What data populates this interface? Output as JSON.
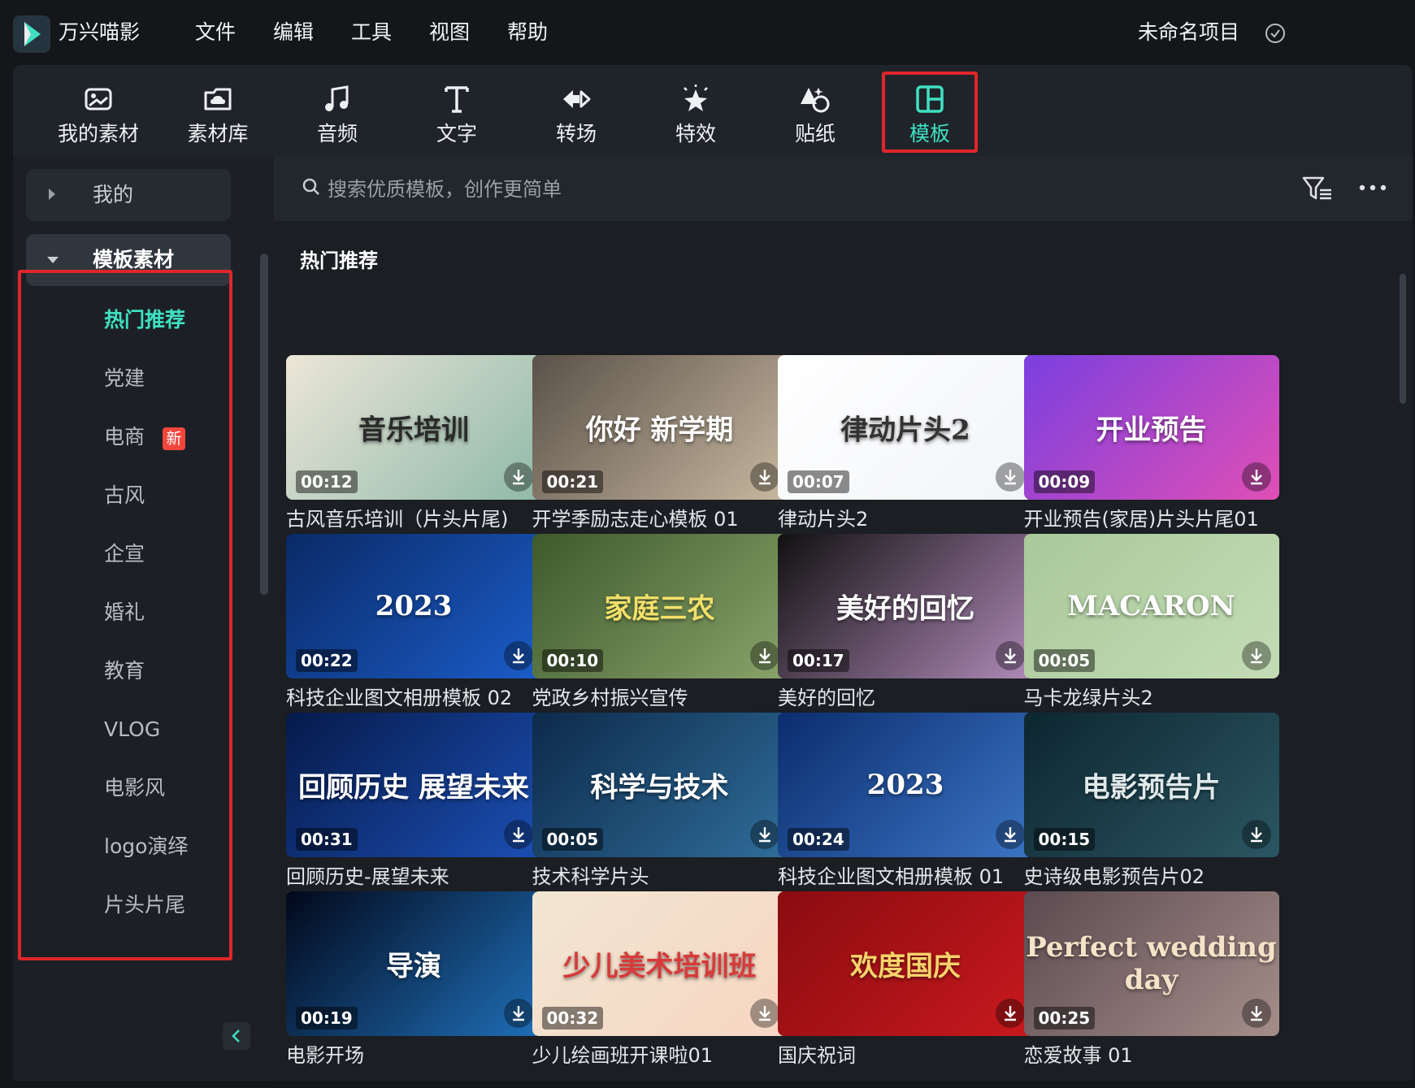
{
  "app": {
    "name": "万兴喵影",
    "project_name": "未命名项目"
  },
  "menu": [
    "文件",
    "编辑",
    "工具",
    "视图",
    "帮助"
  ],
  "toolbar": {
    "tools": [
      {
        "label": "我的素材",
        "icon": "my-media-icon"
      },
      {
        "label": "素材库",
        "icon": "cloud-library-icon"
      },
      {
        "label": "音频",
        "icon": "music-note-icon"
      },
      {
        "label": "文字",
        "icon": "text-icon"
      },
      {
        "label": "转场",
        "icon": "transition-icon"
      },
      {
        "label": "特效",
        "icon": "effects-star-icon"
      },
      {
        "label": "贴纸",
        "icon": "sticker-icon"
      },
      {
        "label": "模板",
        "icon": "template-icon",
        "active": true
      }
    ]
  },
  "sidebar": {
    "mine_label": "我的",
    "group_label": "模板素材",
    "items": [
      "热门推荐",
      "党建",
      "电商",
      "古风",
      "企宣",
      "婚礼",
      "教育",
      "VLOG",
      "电影风",
      "logo演绎",
      "片头片尾"
    ],
    "active_item": "热门推荐",
    "new_badge": "新"
  },
  "search": {
    "placeholder": "搜索优质模板，创作更简单"
  },
  "section_title": "热门推荐",
  "templates": [
    {
      "title": "古风音乐培训（片头片尾)",
      "duration": "00:12",
      "thumb_text": "音乐培训",
      "colors": [
        "#ece6d8",
        "#8fb9a8"
      ],
      "text_color": "#2a2a2a"
    },
    {
      "title": "开学季励志走心模板 01",
      "duration": "00:21",
      "thumb_text": "你好 新学期",
      "colors": [
        "#5a5149",
        "#c8b8a0"
      ],
      "text_color": "#ffffff"
    },
    {
      "title": "律动片头2",
      "duration": "00:07",
      "thumb_text": "律动片头2",
      "colors": [
        "#ffffff",
        "#f2f4f8"
      ],
      "text_color": "#333333"
    },
    {
      "title": "开业预告(家居)片头片尾01",
      "duration": "00:09",
      "thumb_text": "开业预告",
      "colors": [
        "#7b3fe0",
        "#e04fb5"
      ],
      "text_color": "#ffffff"
    },
    {
      "title": "科技企业图文相册模板 02",
      "duration": "00:22",
      "thumb_text": "2023",
      "colors": [
        "#0a2a66",
        "#1b5cc8"
      ],
      "text_color": "#ffffff"
    },
    {
      "title": "党政乡村振兴宣传",
      "duration": "00:10",
      "thumb_text": "家庭三农",
      "colors": [
        "#3e5a2c",
        "#89a36a"
      ],
      "text_color": "#f3e06a"
    },
    {
      "title": "美好的回忆",
      "duration": "00:17",
      "thumb_text": "美好的回忆",
      "colors": [
        "#111111",
        "#b08ab8"
      ],
      "text_color": "#ffffff"
    },
    {
      "title": "马卡龙绿片头2",
      "duration": "00:05",
      "thumb_text": "MACARON",
      "colors": [
        "#a9c99a",
        "#c4dcb6"
      ],
      "text_color": "#ffffff"
    },
    {
      "title": "回顾历史-展望未来",
      "duration": "00:31",
      "thumb_text": "回顾历史 展望未来",
      "colors": [
        "#061a4a",
        "#1b4fb4"
      ],
      "text_color": "#ffffff"
    },
    {
      "title": "技术科学片头",
      "duration": "00:05",
      "thumb_text": "科学与技术",
      "colors": [
        "#0d2a4a",
        "#2f6d9a"
      ],
      "text_color": "#ffffff"
    },
    {
      "title": "科技企业图文相册模板 01",
      "duration": "00:24",
      "thumb_text": "2023",
      "colors": [
        "#0b2d6e",
        "#3b74c4"
      ],
      "text_color": "#ffffff"
    },
    {
      "title": "史诗级电影预告片02",
      "duration": "00:15",
      "thumb_text": "电影预告片",
      "colors": [
        "#0d2630",
        "#2b5663"
      ],
      "text_color": "#dfe8ea"
    },
    {
      "title": "电影开场",
      "duration": "00:19",
      "thumb_text": "导演",
      "colors": [
        "#02081a",
        "#1f6fb8"
      ],
      "text_color": "#ffffff"
    },
    {
      "title": "少儿绘画班开课啦01",
      "duration": "00:32",
      "thumb_text": "少儿美术培训班",
      "colors": [
        "#f1e6d2",
        "#f7d6c2"
      ],
      "text_color": "#d83a3a"
    },
    {
      "title": "国庆祝词",
      "duration": "",
      "thumb_text": "欢度国庆",
      "colors": [
        "#8a0c10",
        "#c8191e"
      ],
      "text_color": "#f6d36b"
    },
    {
      "title": "恋爱故事 01",
      "duration": "00:25",
      "thumb_text": "Perfect wedding day",
      "colors": [
        "#5b4a50",
        "#a58e8a"
      ],
      "text_color": "#f4e3c8"
    }
  ],
  "colors": {
    "accent": "#3fe1c2",
    "highlight_box": "#e0262a",
    "badge": "#f2463c"
  }
}
